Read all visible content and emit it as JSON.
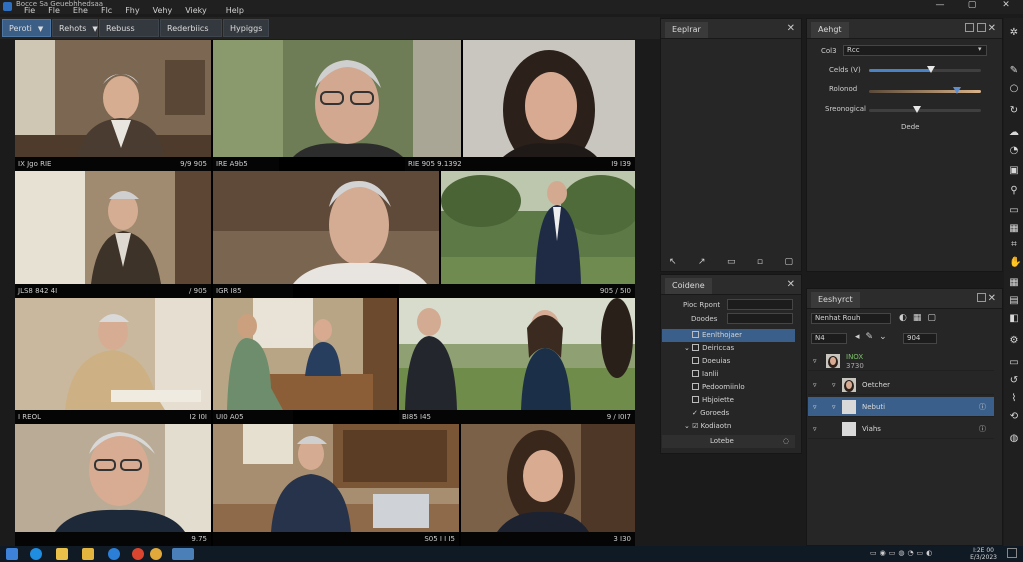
{
  "window": {
    "title": "Bocce Sa Geuebhhedsaa",
    "menu": [
      "Fie",
      "Fle",
      "Ehe",
      "Flc",
      "Fhy",
      "Vehy",
      "Vieky",
      "Help"
    ],
    "controls": [
      "—",
      "▢",
      "✕"
    ]
  },
  "toolbar": {
    "tabs": [
      {
        "label": "Peroti",
        "has_caret": true
      },
      {
        "label": "Rehots",
        "has_caret": true
      },
      {
        "label": "Rebuss",
        "has_caret": false
      },
      {
        "label": "Rederbiics",
        "has_caret": false
      },
      {
        "label": "Hypiggs",
        "has_caret": false
      }
    ]
  },
  "grid": {
    "captions": [
      {
        "left": "IX Jgo RIE",
        "right": "9/9 905"
      },
      {
        "left": "IRE A9b5",
        "right": ""
      },
      {
        "left": "RIE 905 9.1392",
        "right": "I9 I39"
      },
      {
        "left": "JLS8 842 4I",
        "right": "/ 905"
      },
      {
        "left": "IGR I85",
        "right": ""
      },
      {
        "left": "",
        "right": "905 / 5I0"
      },
      {
        "left": "I REOL",
        "right": "I2 I0I"
      },
      {
        "left": "UI0 A05",
        "right": ""
      },
      {
        "left": "BI85 I45",
        "right": "9 / I0I7"
      },
      {
        "left": "",
        "right": "9.75"
      },
      {
        "left": "",
        "right": "S05 I I I5"
      },
      {
        "left": "",
        "right": "3 I30"
      }
    ]
  },
  "panels": {
    "explorer": {
      "tab": "Eeplrar",
      "tools": [
        "↖",
        "↗",
        "▭",
        "▫",
        "▢"
      ]
    },
    "adjust": {
      "tab": "Aehgt",
      "field_label": "Col3",
      "field_value": "Rcc",
      "sliders": [
        {
          "label": "Celds (V)",
          "value": 0.55
        },
        {
          "label": "Rolonod",
          "value": 0.78
        },
        {
          "label": "Sreonogical",
          "value": 0.42
        }
      ],
      "button": "Dede"
    },
    "content": {
      "tab": "Coidene",
      "fields": [
        {
          "label": "Pioc Rpont",
          "value": ""
        },
        {
          "label": "Doodes",
          "value": ""
        }
      ],
      "items": [
        {
          "label": "Eenlthojaer",
          "selected": true,
          "expanded": false,
          "checked": false
        },
        {
          "label": "Deiriccas",
          "selected": false,
          "expanded": true,
          "checked": false
        },
        {
          "label": "Doeuias",
          "selected": false,
          "expanded": false,
          "checked": false
        },
        {
          "label": "Ianlii",
          "selected": false,
          "expanded": false,
          "checked": false
        },
        {
          "label": "Pedoomiinlo",
          "selected": false,
          "expanded": false,
          "checked": false
        },
        {
          "label": "Hbjoiette",
          "selected": false,
          "expanded": false,
          "checked": false
        },
        {
          "label": "Goroeds",
          "selected": false,
          "expanded": false,
          "checked": true
        },
        {
          "label": "Kodiaotn",
          "selected": false,
          "expanded": true,
          "checked": true
        }
      ],
      "footer": "Lotebe"
    },
    "layers": {
      "tab": "Eeshyrct",
      "blend": "Nenhat Rouh",
      "opacity_a": "N4",
      "opacity_b": "904",
      "rows": [
        {
          "label": "INOX",
          "sublabel": "3730",
          "selected": false,
          "thumb": "portrait"
        },
        {
          "label": "Oetcher",
          "sublabel": "",
          "selected": false,
          "thumb": "portrait"
        },
        {
          "label": "Nebuti",
          "sublabel": "",
          "selected": true,
          "thumb": "blank"
        },
        {
          "label": "Viahs",
          "sublabel": "",
          "selected": false,
          "thumb": "blank"
        }
      ]
    }
  },
  "taskbar": {
    "clock_time": "I:2E 00",
    "clock_date": "E/3/2023"
  },
  "colors": {
    "accent": "#3a5f8a",
    "panel": "#262626",
    "background": "#1b1b1b"
  }
}
